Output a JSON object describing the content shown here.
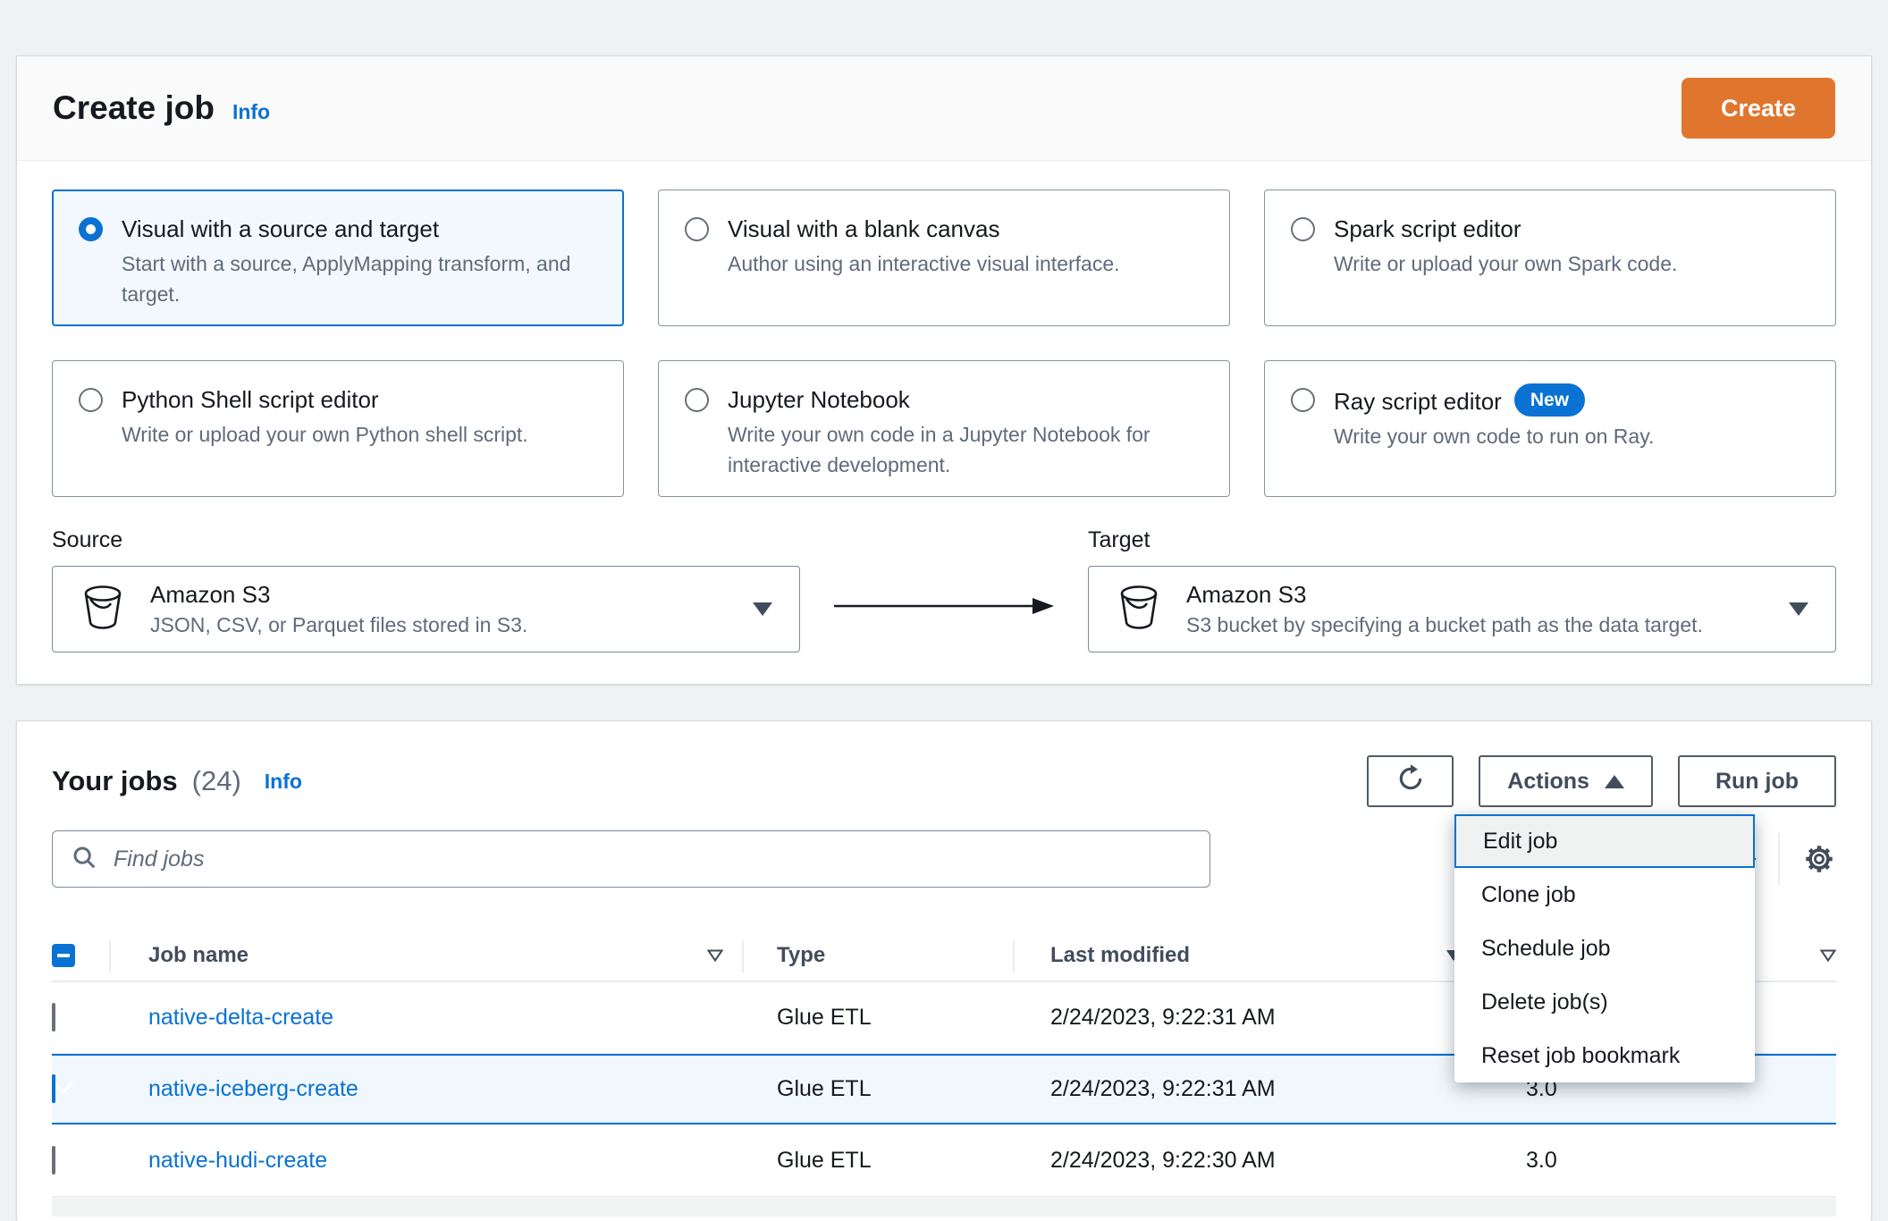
{
  "colors": {
    "accent_blue": "#0972d3",
    "create_button_orange": "#e0762e",
    "link_blue": "#0972d3",
    "selected_card_bg": "#f2f8fd",
    "selected_row_bg": "#f1f8fd",
    "page_bg": "#f0f1f2"
  },
  "create_job": {
    "title": "Create job",
    "info_label": "Info",
    "create_button": "Create",
    "options": [
      {
        "title": "Visual with a source and target",
        "description": "Start with a source, ApplyMapping transform, and target.",
        "selected": true
      },
      {
        "title": "Visual with a blank canvas",
        "description": "Author using an interactive visual interface.",
        "selected": false
      },
      {
        "title": "Spark script editor",
        "description": "Write or upload your own Spark code.",
        "selected": false
      },
      {
        "title": "Python Shell script editor",
        "description": "Write or upload your own Python shell script.",
        "selected": false
      },
      {
        "title": "Jupyter Notebook",
        "description": "Write your own code in a Jupyter Notebook for interactive development.",
        "selected": false
      },
      {
        "title": "Ray script editor",
        "description": "Write your own code to run on Ray.",
        "selected": false,
        "badge": "New"
      }
    ],
    "source": {
      "label": "Source",
      "title": "Amazon S3",
      "description": "JSON, CSV, or Parquet files stored in S3."
    },
    "target": {
      "label": "Target",
      "title": "Amazon S3",
      "description": "S3 bucket by specifying a bucket path as the data target."
    }
  },
  "your_jobs": {
    "title": "Your jobs",
    "count": "(24)",
    "info_label": "Info",
    "actions_button": "Actions",
    "run_job_button": "Run job",
    "search_placeholder": "Find jobs",
    "menu_items": [
      "Edit job",
      "Clone job",
      "Schedule job",
      "Delete job(s)",
      "Reset job bookmark"
    ],
    "table": {
      "columns": [
        "Job name",
        "Type",
        "Last modified"
      ],
      "rows": [
        {
          "name": "native-delta-create",
          "type": "Glue ETL",
          "last_modified": "2/24/2023, 9:22:31 AM",
          "glue_version": "",
          "checked": false
        },
        {
          "name": "native-iceberg-create",
          "type": "Glue ETL",
          "last_modified": "2/24/2023, 9:22:31 AM",
          "glue_version": "3.0",
          "checked": true
        },
        {
          "name": "native-hudi-create",
          "type": "Glue ETL",
          "last_modified": "2/24/2023, 9:22:30 AM",
          "glue_version": "3.0",
          "checked": false
        }
      ]
    }
  }
}
